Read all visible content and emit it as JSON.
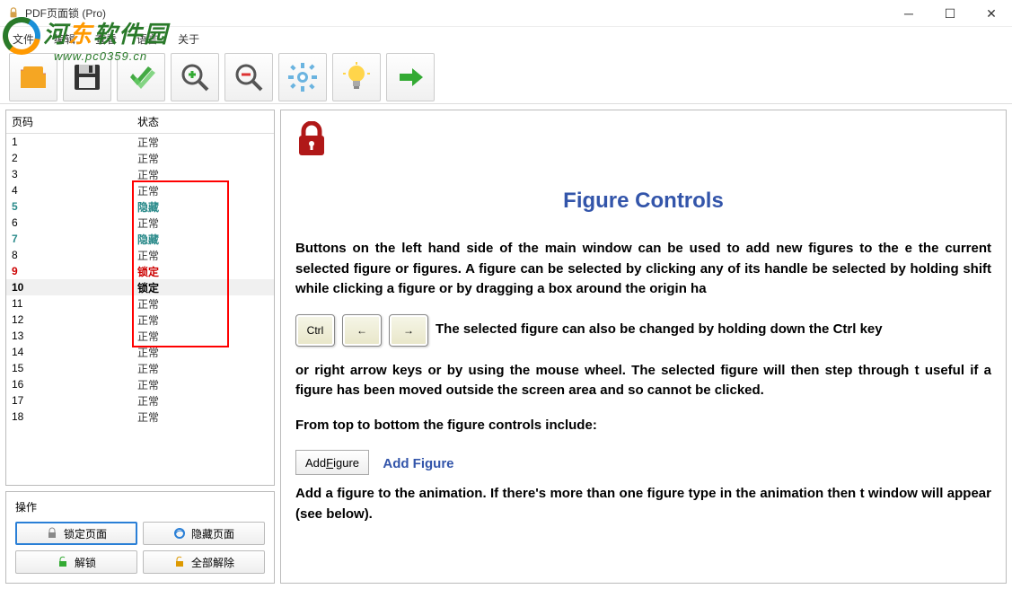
{
  "window": {
    "title": "PDF页面锁 (Pro)"
  },
  "watermark": {
    "text_prefix": "河",
    "text_orange": "东",
    "text_suffix": "软件园",
    "url": "www.pc0359.cn"
  },
  "menu": {
    "file": "文件",
    "edit": "编辑",
    "view": "查看",
    "language": "语言",
    "about": "关于"
  },
  "toolbar_icons": [
    "folder",
    "save",
    "check",
    "zoom-in",
    "zoom-out",
    "gear",
    "bulb",
    "arrow"
  ],
  "list": {
    "header_page": "页码",
    "header_status": "状态",
    "rows": [
      {
        "page": "1",
        "status": "正常",
        "cls": "normal"
      },
      {
        "page": "2",
        "status": "正常",
        "cls": "normal"
      },
      {
        "page": "3",
        "status": "正常",
        "cls": "normal"
      },
      {
        "page": "4",
        "status": "正常",
        "cls": "normal"
      },
      {
        "page": "5",
        "status": "隐藏",
        "cls": "hidden"
      },
      {
        "page": "6",
        "status": "正常",
        "cls": "normal"
      },
      {
        "page": "7",
        "status": "隐藏",
        "cls": "hidden"
      },
      {
        "page": "8",
        "status": "正常",
        "cls": "normal"
      },
      {
        "page": "9",
        "status": "锁定",
        "cls": "locked-red"
      },
      {
        "page": "10",
        "status": "锁定",
        "cls": "locked-sel",
        "selected": true
      },
      {
        "page": "11",
        "status": "正常",
        "cls": "normal"
      },
      {
        "page": "12",
        "status": "正常",
        "cls": "normal"
      },
      {
        "page": "13",
        "status": "正常",
        "cls": "normal"
      },
      {
        "page": "14",
        "status": "正常",
        "cls": "normal"
      },
      {
        "page": "15",
        "status": "正常",
        "cls": "normal"
      },
      {
        "page": "16",
        "status": "正常",
        "cls": "normal"
      },
      {
        "page": "17",
        "status": "正常",
        "cls": "normal"
      },
      {
        "page": "18",
        "status": "正常",
        "cls": "normal"
      }
    ]
  },
  "actions": {
    "title": "操作",
    "lock": "锁定页面",
    "hide": "隐藏页面",
    "unlock": "解锁",
    "unlock_all": "全部解除"
  },
  "doc": {
    "heading": "Figure Controls",
    "p1": "Buttons on the left hand side of the main window can be used to add new figures to the e the current selected figure or figures. A figure can be selected by clicking any of its handle be selected by holding shift while clicking a figure or by dragging a box around the origin ha",
    "key_ctrl": "Ctrl",
    "key_left": "←",
    "key_right": "→",
    "p2a": "The selected figure can also be changed by holding down the Ctrl key",
    "p2b": "or right arrow keys or by using the mouse wheel. The selected figure will then step through t useful if a figure has been moved outside the screen area and so cannot be clicked.",
    "p3": "From top to bottom the figure controls include:",
    "add_figure_btn_pre": "Add ",
    "add_figure_btn_u": "F",
    "add_figure_btn_post": "igure",
    "sub_add_figure": "Add Figure",
    "p4": "Add a figure to the animation. If there's more than one figure type in the animation then t window will appear (see below)."
  }
}
